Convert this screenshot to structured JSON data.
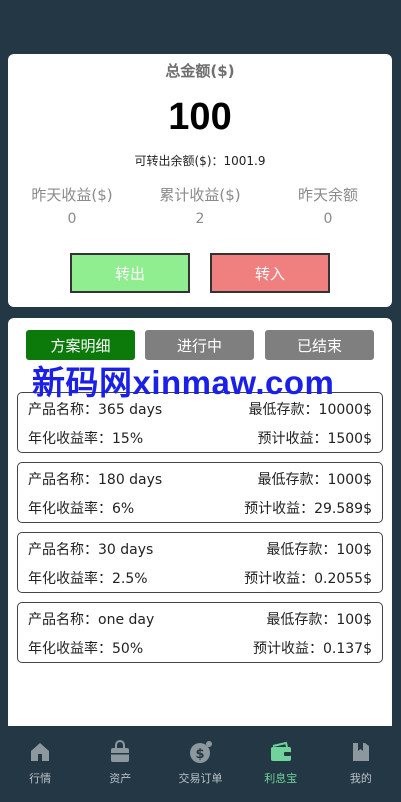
{
  "summary": {
    "total_title": "总金额($)",
    "total_value": "100",
    "transferable": "可转出余额($)：1001.9",
    "stats": [
      {
        "label": "昨天收益($)",
        "value": "0"
      },
      {
        "label": "累计收益($)",
        "value": "2"
      },
      {
        "label": "昨天余额",
        "value": "0"
      }
    ],
    "transfer_out_label": "转出",
    "transfer_in_label": "转入"
  },
  "tabs": [
    {
      "label": "方案明细",
      "active": true
    },
    {
      "label": "进行中",
      "active": false
    },
    {
      "label": "已结束",
      "active": false
    }
  ],
  "watermark": "新码网xinmaw.com",
  "products": [
    {
      "name": "产品名称：365 days",
      "min_deposit": "最低存款：10000$",
      "rate": "年化收益率：15%",
      "expected": "预计收益：1500$"
    },
    {
      "name": "产品名称：180 days",
      "min_deposit": "最低存款：1000$",
      "rate": "年化收益率：6%",
      "expected": "预计收益：29.589$"
    },
    {
      "name": "产品名称：30 days",
      "min_deposit": "最低存款：100$",
      "rate": "年化收益率：2.5%",
      "expected": "预计收益：0.2055$"
    },
    {
      "name": "产品名称：one day",
      "min_deposit": "最低存款：100$",
      "rate": "年化收益率：50%",
      "expected": "预计收益：0.137$"
    }
  ],
  "nav": [
    {
      "label": "行情",
      "icon": "home-icon",
      "active": false
    },
    {
      "label": "资产",
      "icon": "bag-icon",
      "active": false
    },
    {
      "label": "交易订单",
      "icon": "dollar-coin-icon",
      "active": false
    },
    {
      "label": "利息宝",
      "icon": "wallet-icon",
      "active": true
    },
    {
      "label": "我的",
      "icon": "book-icon",
      "active": false
    }
  ],
  "colors": {
    "background": "#243744",
    "transfer_out": "#90ee90",
    "transfer_in": "#f08080",
    "tab_active": "#0b7a0b",
    "tab_inactive": "#7f7f7f",
    "nav_active": "#6fd39b",
    "watermark": "#1a20e8"
  }
}
